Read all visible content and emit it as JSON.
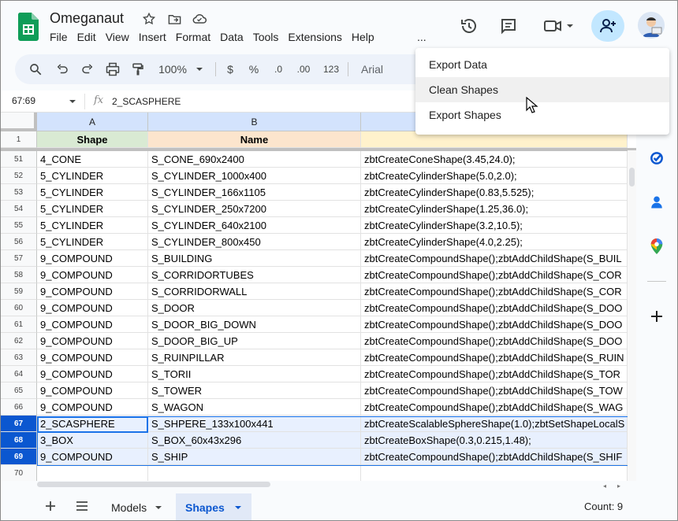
{
  "header": {
    "title": "Omeganaut",
    "menu": [
      "File",
      "Edit",
      "View",
      "Insert",
      "Format",
      "Data",
      "Tools",
      "Extensions",
      "Help"
    ],
    "more": "...",
    "icons": [
      "star-icon",
      "move-to-folder-icon",
      "cloud-status-icon",
      "history-icon",
      "comment-icon",
      "meet-icon",
      "share-icon"
    ]
  },
  "toolbar": {
    "zoom": "100%",
    "currency": "$",
    "percent": "%",
    "decrease_decimal": ".0",
    "increase_decimal": ".00",
    "number_format": "123",
    "font": "Arial"
  },
  "formula_bar": {
    "name_box": "67:69",
    "fx": "fx",
    "formula": "2_SCASPHERE"
  },
  "columns": [
    "A",
    "B",
    ""
  ],
  "header_row": {
    "num": "1",
    "cells": [
      "Shape",
      "Name",
      ""
    ]
  },
  "rows": [
    {
      "num": "51",
      "a": "4_CONE",
      "b": "S_CONE_690x2400",
      "c": "zbtCreateConeShape(3.45,24.0);"
    },
    {
      "num": "52",
      "a": "5_CYLINDER",
      "b": "S_CYLINDER_1000x400",
      "c": "zbtCreateCylinderShape(5.0,2.0);"
    },
    {
      "num": "53",
      "a": "5_CYLINDER",
      "b": "S_CYLINDER_166x1105",
      "c": "zbtCreateCylinderShape(0.83,5.525);"
    },
    {
      "num": "54",
      "a": "5_CYLINDER",
      "b": "S_CYLINDER_250x7200",
      "c": "zbtCreateCylinderShape(1.25,36.0);"
    },
    {
      "num": "55",
      "a": "5_CYLINDER",
      "b": "S_CYLINDER_640x2100",
      "c": "zbtCreateCylinderShape(3.2,10.5);"
    },
    {
      "num": "56",
      "a": "5_CYLINDER",
      "b": "S_CYLINDER_800x450",
      "c": "zbtCreateCylinderShape(4.0,2.25);"
    },
    {
      "num": "57",
      "a": "9_COMPOUND",
      "b": "S_BUILDING",
      "c": "zbtCreateCompoundShape();zbtAddChildShape(S_BUIL"
    },
    {
      "num": "58",
      "a": "9_COMPOUND",
      "b": "S_CORRIDORTUBES",
      "c": "zbtCreateCompoundShape();zbtAddChildShape(S_COR"
    },
    {
      "num": "59",
      "a": "9_COMPOUND",
      "b": "S_CORRIDORWALL",
      "c": "zbtCreateCompoundShape();zbtAddChildShape(S_COR"
    },
    {
      "num": "60",
      "a": "9_COMPOUND",
      "b": "S_DOOR",
      "c": "zbtCreateCompoundShape();zbtAddChildShape(S_DOO"
    },
    {
      "num": "61",
      "a": "9_COMPOUND",
      "b": "S_DOOR_BIG_DOWN",
      "c": "zbtCreateCompoundShape();zbtAddChildShape(S_DOO"
    },
    {
      "num": "62",
      "a": "9_COMPOUND",
      "b": "S_DOOR_BIG_UP",
      "c": "zbtCreateCompoundShape();zbtAddChildShape(S_DOO"
    },
    {
      "num": "63",
      "a": "9_COMPOUND",
      "b": "S_RUINPILLAR",
      "c": "zbtCreateCompoundShape();zbtAddChildShape(S_RUIN"
    },
    {
      "num": "64",
      "a": "9_COMPOUND",
      "b": "S_TORII",
      "c": "zbtCreateCompoundShape();zbtAddChildShape(S_TOR"
    },
    {
      "num": "65",
      "a": "9_COMPOUND",
      "b": "S_TOWER",
      "c": "zbtCreateCompoundShape();zbtAddChildShape(S_TOW"
    },
    {
      "num": "66",
      "a": "9_COMPOUND",
      "b": "S_WAGON",
      "c": "zbtCreateCompoundShape();zbtAddChildShape(S_WAG"
    },
    {
      "num": "67",
      "a": "2_SCASPHERE",
      "b": "S_SHPERE_133x100x441",
      "c": "zbtCreateScalableSphereShape(1.0);zbtSetShapeLocalS",
      "sel": true
    },
    {
      "num": "68",
      "a": "3_BOX",
      "b": "S_BOX_60x43x296",
      "c": "zbtCreateBoxShape(0.3,0.215,1.48);",
      "sel": true
    },
    {
      "num": "69",
      "a": "9_COMPOUND",
      "b": "S_SHIP",
      "c": "zbtCreateCompoundShape();zbtAddChildShape(S_SHIF",
      "sel": true
    },
    {
      "num": "70",
      "a": "",
      "b": "",
      "c": ""
    }
  ],
  "dropdown": {
    "items": [
      "Export Data",
      "Clean Shapes",
      "Export Shapes"
    ],
    "hovered": "Clean Shapes"
  },
  "sheets": {
    "tabs": [
      "Models",
      "Shapes"
    ],
    "active": "Shapes",
    "count": "Count: 9"
  },
  "colors": {
    "accent": "#0b57d0",
    "share_bg": "#c2e7ff",
    "selected_row_bg": "#e8f0fe",
    "col_a_header_bg": "#d9ead3",
    "col_b_header_bg": "#fce5cd",
    "col_c_header_bg": "#fff2cc"
  }
}
